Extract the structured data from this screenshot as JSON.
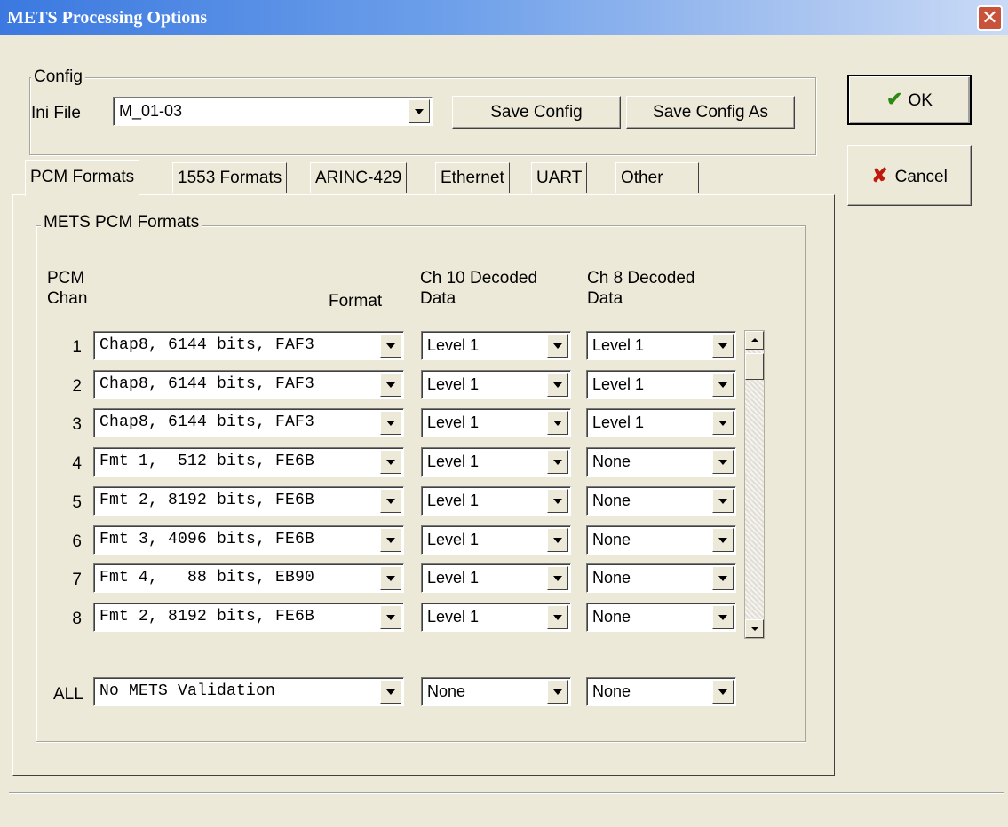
{
  "window": {
    "title": "METS Processing Options"
  },
  "config": {
    "group_label": "Config",
    "ini_label": "Ini File",
    "ini_value": "M_01-03",
    "save_label": "Save Config",
    "save_as_label": "Save Config As"
  },
  "buttons": {
    "ok_label": "OK",
    "cancel_label": "Cancel"
  },
  "tabs": [
    {
      "label": "PCM Formats"
    },
    {
      "label": "1553 Formats"
    },
    {
      "label": "ARINC-429"
    },
    {
      "label": "Ethernet"
    },
    {
      "label": "UART"
    },
    {
      "label": "Other"
    }
  ],
  "pcm": {
    "group_label": "METS PCM Formats",
    "col_chan_1": "PCM",
    "col_chan_2": "Chan",
    "col_format": "Format",
    "col_ch10_1": "Ch 10 Decoded",
    "col_ch10_2": "Data",
    "col_ch8_1": "Ch 8 Decoded",
    "col_ch8_2": "Data",
    "rows": [
      {
        "num": "1",
        "format": "Chap8, 6144 bits, FAF3",
        "ch10": "Level 1",
        "ch8": "Level 1"
      },
      {
        "num": "2",
        "format": "Chap8, 6144 bits, FAF3",
        "ch10": "Level 1",
        "ch8": "Level 1"
      },
      {
        "num": "3",
        "format": "Chap8, 6144 bits, FAF3",
        "ch10": "Level 1",
        "ch8": "Level 1"
      },
      {
        "num": "4",
        "format": "Fmt 1,  512 bits, FE6B",
        "ch10": "Level 1",
        "ch8": "None"
      },
      {
        "num": "5",
        "format": "Fmt 2, 8192 bits, FE6B",
        "ch10": "Level 1",
        "ch8": "None"
      },
      {
        "num": "6",
        "format": "Fmt 3, 4096 bits, FE6B",
        "ch10": "Level 1",
        "ch8": "None"
      },
      {
        "num": "7",
        "format": "Fmt 4,   88 bits, EB90",
        "ch10": "Level 1",
        "ch8": "None"
      },
      {
        "num": "8",
        "format": "Fmt 2, 8192 bits, FE6B",
        "ch10": "Level 1",
        "ch8": "None"
      }
    ],
    "all": {
      "label": "ALL",
      "format": "No METS Validation",
      "ch10": "None",
      "ch8": "None"
    }
  }
}
